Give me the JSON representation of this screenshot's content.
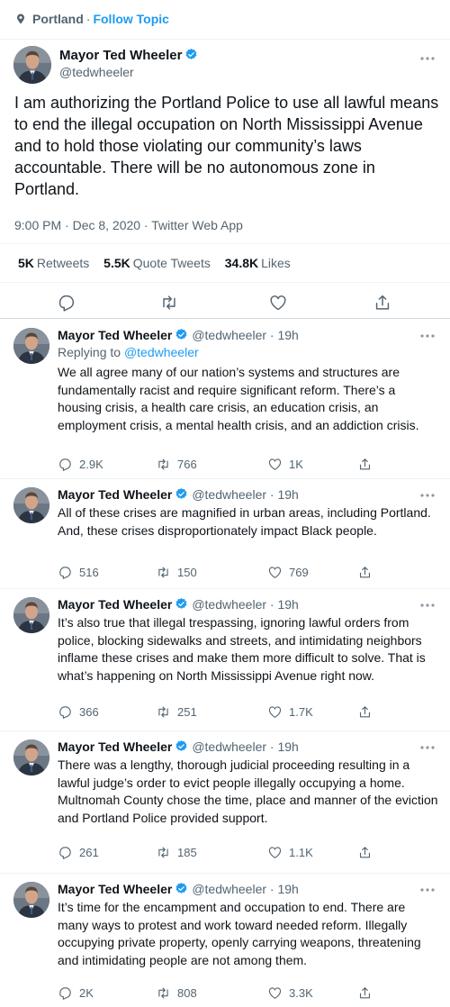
{
  "topic": {
    "name": "Portland",
    "separator": "·",
    "follow_label": "Follow Topic"
  },
  "main_tweet": {
    "author_name": "Mayor Ted Wheeler",
    "handle": "@tedwheeler",
    "text": "I am authorizing the Portland Police to use all lawful means to end the illegal occupation on North Mississippi Avenue and to hold those violating our community’s laws accountable. There will be no autonomous zone in Portland.",
    "timestamp": "9:00 PM · Dec 8, 2020 · Twitter Web App",
    "stats": {
      "retweets_count": "5K",
      "retweets_label": "Retweets",
      "quotes_count": "5.5K",
      "quotes_label": "Quote Tweets",
      "likes_count": "34.8K",
      "likes_label": "Likes"
    }
  },
  "replies": [
    {
      "author_name": "Mayor Ted Wheeler",
      "handle": "@tedwheeler",
      "time": "· 19h",
      "replying_prefix": "Replying to",
      "replying_to": "@tedwheeler",
      "text": "We all agree many of our nation’s systems and structures are fundamentally racist and require significant reform. There’s a housing crisis, a health care crisis, an education crisis, an employment crisis, a mental health crisis, and an addiction crisis.",
      "replies": "2.9K",
      "retweets": "766",
      "likes": "1K"
    },
    {
      "author_name": "Mayor Ted Wheeler",
      "handle": "@tedwheeler",
      "time": "· 19h",
      "text": "All of these crises are magnified in urban areas, including Portland. And, these crises disproportionately impact Black people.",
      "replies": "516",
      "retweets": "150",
      "likes": "769"
    },
    {
      "author_name": "Mayor Ted Wheeler",
      "handle": "@tedwheeler",
      "time": "· 19h",
      "text": "It’s also true that illegal trespassing, ignoring lawful orders from police, blocking sidewalks and streets, and intimidating neighbors inflame these crises and make them more difficult to solve. That is what’s happening on North Mississippi Avenue right now.",
      "replies": "366",
      "retweets": "251",
      "likes": "1.7K"
    },
    {
      "author_name": "Mayor Ted Wheeler",
      "handle": "@tedwheeler",
      "time": "· 19h",
      "text": "There was a lengthy, thorough judicial proceeding resulting in a lawful judge’s order to evict people illegally occupying a home. Multnomah County chose the time, place and manner of the eviction and Portland Police provided support.",
      "replies": "261",
      "retweets": "185",
      "likes": "1.1K"
    },
    {
      "author_name": "Mayor Ted Wheeler",
      "handle": "@tedwheeler",
      "time": "· 19h",
      "text": "It’s time for the encampment and occupation to end. There are many ways to protest and work toward needed reform. Illegally occupying private property, openly carrying weapons, threatening and intimidating people are not among them.",
      "replies": "2K",
      "retweets": "808",
      "likes": "3.3K"
    }
  ],
  "colors": {
    "accent": "#1d9bf0",
    "text": "#0f1419",
    "secondary": "#536471",
    "divider": "#eff3f4"
  },
  "icons": [
    "location-pin-icon",
    "verified-badge-icon",
    "more-options-icon",
    "reply-icon",
    "retweet-icon",
    "like-icon",
    "share-icon"
  ]
}
